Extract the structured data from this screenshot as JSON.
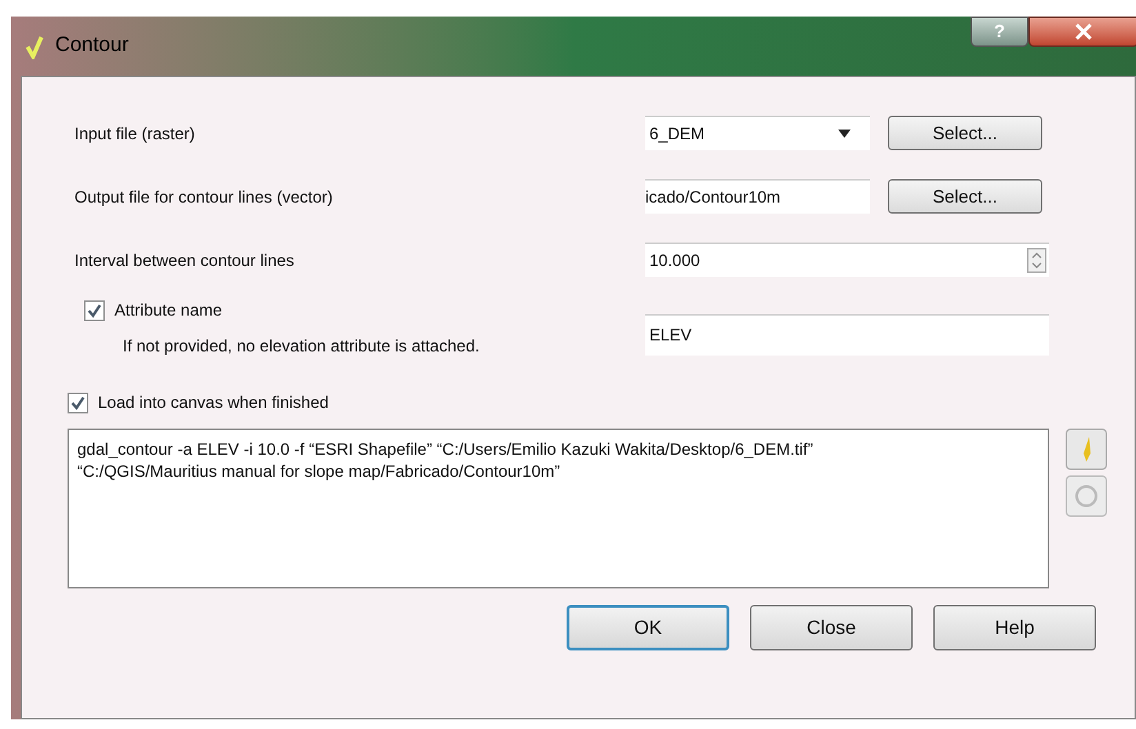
{
  "window": {
    "title": "Contour",
    "help_glyph": "?"
  },
  "fields": [
    {
      "kind": "combo",
      "label": "Input file (raster)",
      "value": "6_DEM",
      "button": "Select..."
    },
    {
      "kind": "file",
      "label": "Output file for contour lines (vector)",
      "value": "icado/Contour10m",
      "button": "Select..."
    },
    {
      "kind": "spin",
      "label": "Interval between contour lines",
      "value": "10.000"
    }
  ],
  "attribute": {
    "label": "Attribute name",
    "checked": true,
    "hint": "If not provided, no elevation attribute is attached.",
    "value": "ELEV"
  },
  "load_into_canvas": {
    "label": "Load into canvas when finished",
    "checked": true
  },
  "command": "gdal_contour -a ELEV -i 10.0 -f “ESRI Shapefile” “C:/Users/Emilio Kazuki Wakita/Desktop/6_DEM.tif” “C:/QGIS/Mauritius manual for slope map/Fabricado/Contour10m”",
  "buttons": [
    {
      "label": "OK",
      "selected": true
    },
    {
      "label": "Close",
      "selected": false
    },
    {
      "label": "Help",
      "selected": false
    }
  ]
}
